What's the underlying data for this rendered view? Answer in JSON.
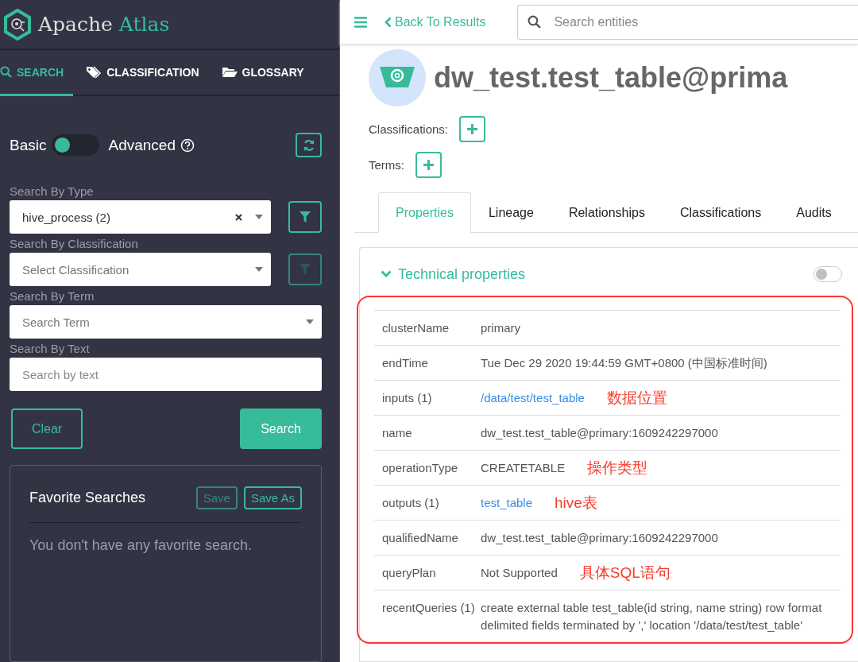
{
  "brand": {
    "name": "Apache",
    "accent": "Atlas"
  },
  "nav_tabs": [
    {
      "label": "SEARCH",
      "selected": true
    },
    {
      "label": "CLASSIFICATION",
      "selected": false
    },
    {
      "label": "GLOSSARY",
      "selected": false
    }
  ],
  "mode_toggle": {
    "left_label": "Basic",
    "right_label": "Advanced",
    "advanced": false
  },
  "filters": [
    {
      "label": "Search By Type",
      "kind": "select",
      "value": "hive_process (2)",
      "filter_disabled": false
    },
    {
      "label": "Search By Classification",
      "kind": "select",
      "placeholder": "Select Classification",
      "filter_disabled": true
    },
    {
      "label": "Search By Term",
      "kind": "select",
      "placeholder": "Search Term"
    },
    {
      "label": "Search By Text",
      "kind": "text",
      "placeholder": "Search by text"
    }
  ],
  "actions": {
    "clear": "Clear",
    "search": "Search"
  },
  "favorites": {
    "title": "Favorite Searches",
    "save": {
      "label": "Save",
      "disabled": true
    },
    "save_as": {
      "label": "Save As",
      "disabled": false
    },
    "empty_text": "You don't have any favorite search."
  },
  "header": {
    "back_link": "Back To Results",
    "search_placeholder": "Search entities"
  },
  "entity": {
    "title": "dw_test.test_table@prima"
  },
  "classifications_label": "Classifications:",
  "terms_label": "Terms:",
  "detail_tabs": [
    {
      "label": "Properties",
      "selected": true
    },
    {
      "label": "Lineage",
      "selected": false
    },
    {
      "label": "Relationships",
      "selected": false
    },
    {
      "label": "Classifications",
      "selected": false
    },
    {
      "label": "Audits",
      "selected": false
    }
  ],
  "technical_properties": {
    "title": "Technical properties",
    "expanded": true,
    "show_empty": false,
    "rows": [
      {
        "key": "clusterName",
        "value": "primary",
        "kind": "text"
      },
      {
        "key": "endTime",
        "value": "Tue Dec 29 2020 19:44:59 GMT+0800 (中国标准时间)",
        "kind": "text"
      },
      {
        "key": "inputs (1)",
        "value": "/data/test/test_table",
        "kind": "link",
        "note": "数据位置"
      },
      {
        "key": "name",
        "value": "dw_test.test_table@primary:1609242297000",
        "kind": "text"
      },
      {
        "key": "operationType",
        "value": "CREATETABLE",
        "kind": "text",
        "note": "操作类型"
      },
      {
        "key": "outputs (1)",
        "value": "test_table",
        "kind": "link",
        "note": "hive表"
      },
      {
        "key": "qualifiedName",
        "value": "dw_test.test_table@primary:1609242297000",
        "kind": "text"
      },
      {
        "key": "queryPlan",
        "value": "Not Supported",
        "kind": "text",
        "note": "具体SQL语句"
      },
      {
        "key": "recentQueries (1)",
        "value": "create external table test_table(id string, name string) row format delimited fields terminated by ',' location '/data/test/test_table'",
        "kind": "text"
      }
    ]
  }
}
